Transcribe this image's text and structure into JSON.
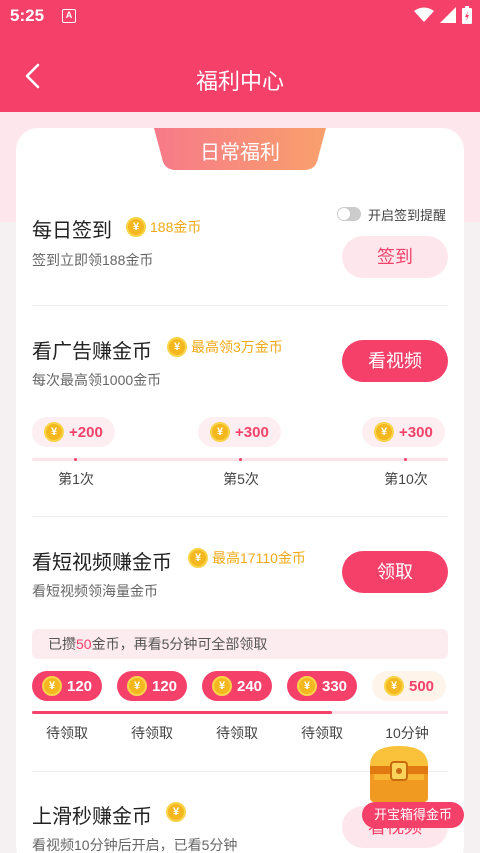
{
  "status": {
    "time": "5:25",
    "a_icon": "A"
  },
  "header": {
    "title": "福利中心",
    "back_icon": "chevron-left-icon"
  },
  "ribbon": {
    "label": "日常福利"
  },
  "checkin": {
    "title": "每日签到",
    "reward": "188金币",
    "subtitle": "签到立即领188金币",
    "toggle_label": "开启签到提醒",
    "button": "签到"
  },
  "ads": {
    "title": "看广告赚金币",
    "reward": "最高领3万金币",
    "subtitle": "每次最高领1000金币",
    "button": "看视频",
    "steps": [
      {
        "amount": "+200",
        "label": "第1次"
      },
      {
        "amount": "+300",
        "label": "第5次"
      },
      {
        "amount": "+300",
        "label": "第10次"
      }
    ]
  },
  "shortvideo": {
    "title": "看短视频赚金币",
    "reward": "最高17110金币",
    "subtitle": "看短视频领海量金币",
    "button": "领取",
    "notice_prefix": "已攒",
    "notice_amount": "50",
    "notice_suffix": "金币，再看5分钟可全部领取",
    "steps": [
      {
        "amount": "120",
        "label": "待领取",
        "state": "ready"
      },
      {
        "amount": "120",
        "label": "待领取",
        "state": "ready"
      },
      {
        "amount": "240",
        "label": "待领取",
        "state": "ready"
      },
      {
        "amount": "330",
        "label": "待领取",
        "state": "ready"
      },
      {
        "amount": "500",
        "label": "10分钟",
        "state": "locked"
      }
    ]
  },
  "swipe": {
    "title": "上滑秒赚金币",
    "subtitle": "看视频10分钟后开启，已看5分钟",
    "button": "看视频"
  },
  "treasure": {
    "label": "开宝箱得金币"
  },
  "colors": {
    "accent": "#f5416a",
    "gold": "#f0a915",
    "light_pink": "#fde7ec"
  }
}
